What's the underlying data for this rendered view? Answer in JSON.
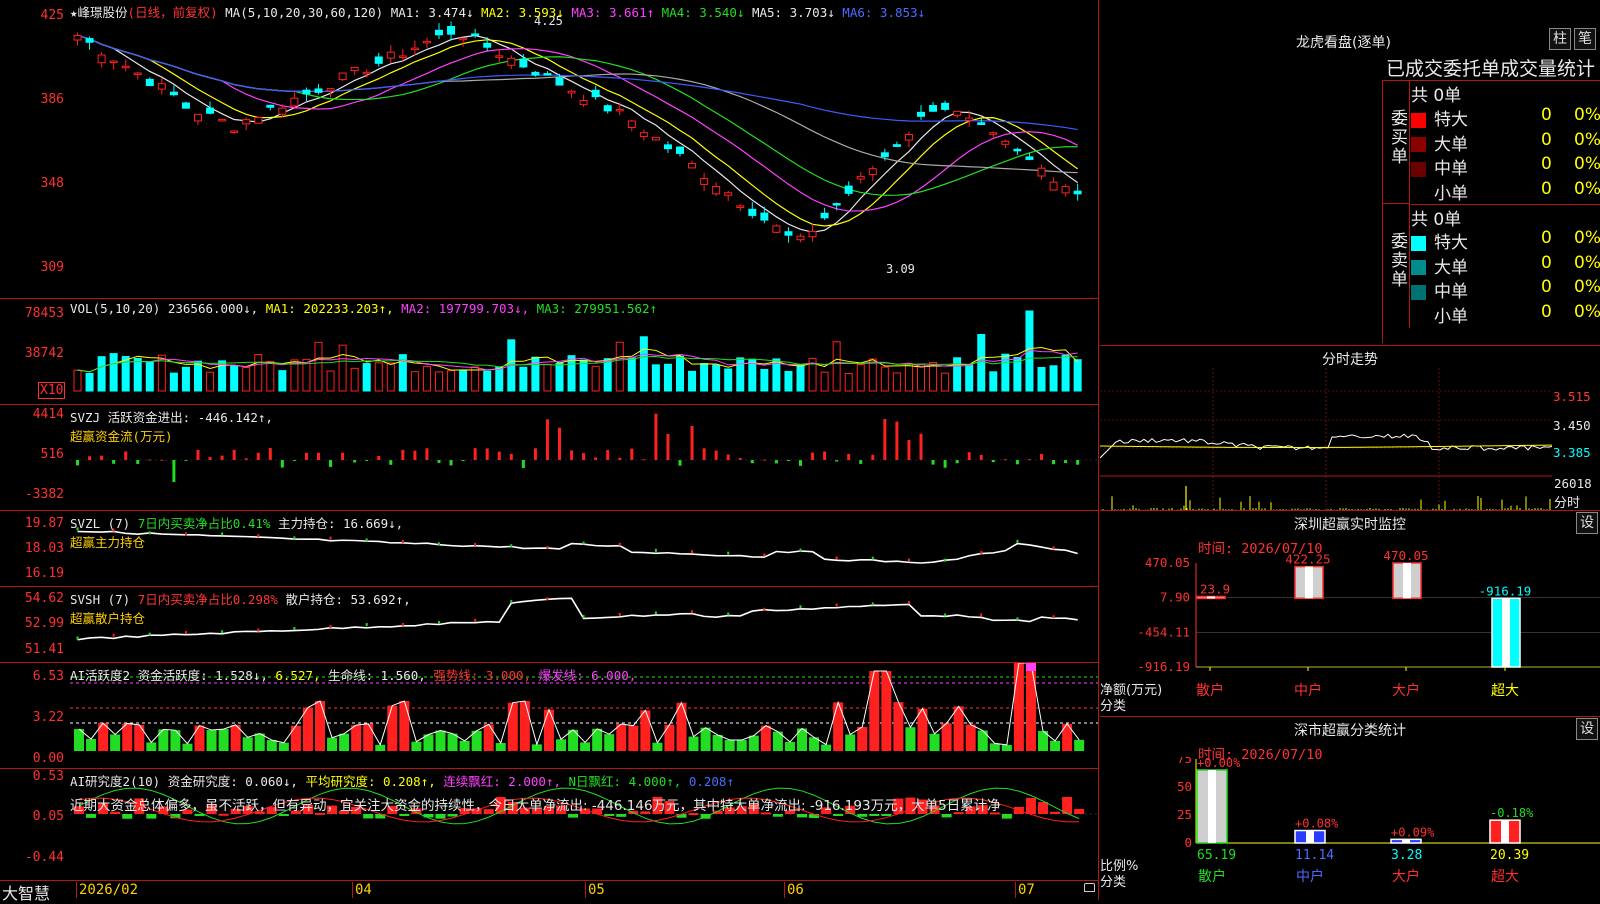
{
  "stock": {
    "star": "★",
    "name": "峰璟股份",
    "period": "(日线，前复权)",
    "ma_label": "MA(5,10,20,30,60,120)",
    "ma": [
      {
        "label": "MA1:",
        "value": "3.474↓",
        "color": "#e8e8e8"
      },
      {
        "label": "MA2:",
        "value": "3.593↓",
        "color": "#ffff00"
      },
      {
        "label": "MA3:",
        "value": "3.661↑",
        "color": "#ff40ff"
      },
      {
        "label": "MA4:",
        "value": "3.540↓",
        "color": "#22dd22"
      },
      {
        "label": "MA5:",
        "value": "3.703↓",
        "color": "#e8e8e8"
      },
      {
        "label": "MA6:",
        "value": "3.853↓",
        "color": "#4a6bff"
      }
    ],
    "high_mark": "4.25",
    "low_mark": "3.09",
    "price_ticks": [
      "425",
      "386",
      "348",
      "309"
    ]
  },
  "vol": {
    "legend_name": "VOL(5,10,20)",
    "value": "236566.000↓,",
    "ma1": "MA1: 202233.203↑,",
    "ma2": "MA2: 197799.703↓,",
    "ma3": "MA3: 279951.562↑",
    "ticks": [
      "78453",
      "38742"
    ],
    "unit": "X10"
  },
  "svzj": {
    "legend_name": "SVZJ",
    "label": "活跃资金进出: -446.142↑,",
    "sub": "超赢资金流(万元)",
    "ticks": [
      "4414",
      "516",
      "-3382"
    ]
  },
  "svzl": {
    "legend_name": "SVZL (7)",
    "ratio": "7日内买卖净占比0.41%",
    "hold": "主力持仓: 16.669↓,",
    "sub": "超赢主力持仓",
    "ticks": [
      "19.87",
      "18.03",
      "16.19"
    ]
  },
  "svsh": {
    "legend_name": "SVSH (7)",
    "ratio": "7日内买卖净占比0.298%",
    "hold": "散户持仓: 53.692↑,",
    "sub": "超赢散户持仓",
    "ticks": [
      "54.62",
      "52.99",
      "51.41"
    ]
  },
  "ai_active": {
    "name": "AI活跃度2",
    "active": "资金活跃度: 1.528↓,",
    "v2": "6.527,",
    "life": "生命线: 1.560,",
    "strong": "强势线: 3.000,",
    "burst": "爆发线: 6.000,",
    "ticks": [
      "6.53",
      "3.22",
      "0.00"
    ]
  },
  "ai_research": {
    "name": "AI研究度2(10)",
    "research": "资金研究度: 0.060↓,",
    "avg": "平均研究度: 0.208↑,",
    "red": "连续飘红: 2.000↑,",
    "nred": "N日飘红: 4.000↑,",
    "last": "0.208↑",
    "comment": "近期大资金总体偏多，虽不活跃，但有异动，宜关注大资金的持续性，今日大单净流出: -446.146万元，其中特大单净流出: -916.193万元，大单5日累计净",
    "ticks": [
      "0.53",
      "0.05",
      "-0.44"
    ]
  },
  "xaxis": {
    "brand": "大智慧",
    "labels": [
      "2026/02",
      "04",
      "05",
      "06",
      "07"
    ]
  },
  "dragon": {
    "title": "龙虎看盘(逐单)",
    "btn1": "柱",
    "btn2": "笔",
    "header": "已成交委托单成交量统计",
    "buy_label": "委买单",
    "sell_label": "委卖单",
    "buy_total": "共 0单",
    "sell_total": "共 0单",
    "buy_rows": [
      {
        "name": "特大",
        "val": "0",
        "pct": "0%",
        "color": "#ff0000"
      },
      {
        "name": "大单",
        "val": "0",
        "pct": "0%",
        "color": "#8a0000"
      },
      {
        "name": "中单",
        "val": "0",
        "pct": "0%",
        "color": "#6a0000"
      },
      {
        "name": "小单",
        "val": "0",
        "pct": "0%",
        "color": ""
      }
    ],
    "sell_rows": [
      {
        "name": "特大",
        "val": "0",
        "pct": "0%",
        "color": "#00ffff"
      },
      {
        "name": "大单",
        "val": "0",
        "pct": "0%",
        "color": "#008c8c"
      },
      {
        "name": "中单",
        "val": "0",
        "pct": "0%",
        "color": "#007070"
      },
      {
        "name": "小单",
        "val": "0",
        "pct": "0%",
        "color": ""
      }
    ]
  },
  "intraday": {
    "title": "分时走势",
    "ticks": [
      "3.515",
      "3.450",
      "3.385"
    ],
    "vol_tick": "26018",
    "vol_label": "分时"
  },
  "monitor": {
    "title": "深圳超赢实时监控",
    "btn": "设",
    "time": "时间: 2026/07/10",
    "ticks": [
      "470.05",
      "7.90",
      "-454.11",
      "-916.19"
    ],
    "unit1": "净额(万元)",
    "unit2": "分类",
    "categories": [
      "散户",
      "中户",
      "大户",
      "超大"
    ],
    "values": [
      23.9,
      422.25,
      470.05,
      -916.19
    ],
    "value_labels": [
      "23.9",
      "422.25",
      "470.05",
      "-916.19"
    ]
  },
  "classify": {
    "title": "深市超赢分类统计",
    "btn": "设",
    "time": "时间: 2026/07/10",
    "ticks": [
      "75",
      "50",
      "25",
      "0"
    ],
    "unit1": "比例%",
    "unit2": "分类",
    "categories": [
      "散户",
      "中户",
      "大户",
      "超大"
    ],
    "values": [
      65.19,
      11.14,
      3.28,
      20.39
    ],
    "value_labels": [
      "65.19",
      "11.14",
      "3.28",
      "20.39"
    ],
    "changes": [
      "+0.00%",
      "+0.08%",
      "+0.09%",
      "-0.18%"
    ]
  },
  "chart_data": [
    {
      "type": "bar",
      "title": "深圳超赢实时监控",
      "categories": [
        "散户",
        "中户",
        "大户",
        "超大"
      ],
      "series": [
        {
          "name": "净额(万元)",
          "values": [
            23.9,
            422.25,
            470.05,
            -916.19
          ]
        }
      ],
      "ylim": [
        -916.19,
        470.05
      ]
    },
    {
      "type": "bar",
      "title": "深市超赢分类统计",
      "categories": [
        "散户",
        "中户",
        "大户",
        "超大"
      ],
      "series": [
        {
          "name": "比例%",
          "values": [
            65.19,
            11.14,
            3.28,
            20.39
          ]
        }
      ],
      "ylim": [
        0,
        75
      ]
    }
  ],
  "colors": {
    "up": "#ff2020",
    "down": "#00ffff",
    "grid": "#b01818",
    "bg": "#000000"
  }
}
